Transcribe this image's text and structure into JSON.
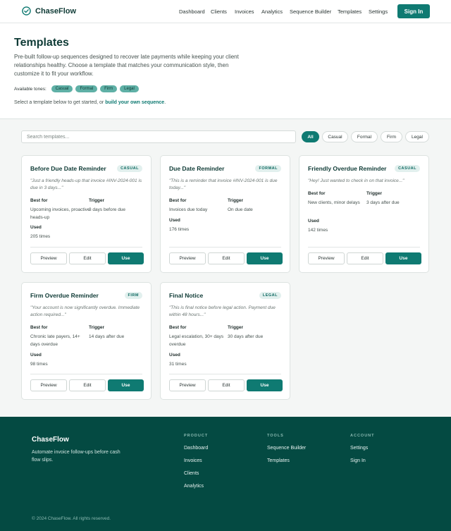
{
  "nav": {
    "brand": "ChaseFlow",
    "links": [
      "Dashboard",
      "Clients",
      "Invoices",
      "Analytics",
      "Sequence Builder",
      "Templates",
      "Settings"
    ],
    "signin": "Sign In"
  },
  "hero": {
    "title": "Templates",
    "description": "Pre-built follow-up sequences designed to recover late payments while keeping your client relationships healthy. Choose a template that matches your communication style, then customize it to fit your workflow.",
    "tones_label": "Available tones:",
    "tones": [
      "Casual",
      "Formal",
      "Firm",
      "Legal"
    ],
    "hint_prefix": "Select a template below to get started, or ",
    "hint_link": "build your own sequence",
    "hint_suffix": "."
  },
  "filters": {
    "search_placeholder": "Search templates...",
    "buttons": [
      "All",
      "Casual",
      "Formal",
      "Firm",
      "Legal"
    ],
    "active": "All"
  },
  "labels": {
    "best_for": "Best for",
    "trigger": "Trigger",
    "used": "Used",
    "preview": "Preview",
    "edit": "Edit",
    "use": "Use"
  },
  "templates": [
    {
      "title": "Before Due Date Reminder",
      "tone": "CASUAL",
      "quote": "\"Just a friendly heads-up that invoice #INV-2024-001 is due in 3 days...\"",
      "best_for": "Upcoming invoices, proactive heads-up",
      "trigger": "3 days before due",
      "used": "205 times"
    },
    {
      "title": "Due Date Reminder",
      "tone": "FORMAL",
      "quote": "\"This is a reminder that invoice #INV-2024-001 is due today...\"",
      "best_for": "Invoices due today",
      "trigger": "On due date",
      "used": "176 times"
    },
    {
      "title": "Friendly Overdue Reminder",
      "tone": "CASUAL",
      "quote": "\"Hey! Just wanted to check in on that invoice...\"",
      "best_for": "New clients, minor delays",
      "trigger": "3 days after due",
      "used": "142 times"
    },
    {
      "title": "Firm Overdue Reminder",
      "tone": "FIRM",
      "quote": "\"Your account is now significantly overdue. Immediate action required...\"",
      "best_for": "Chronic late payers, 14+ days overdue",
      "trigger": "14 days after due",
      "used": "98 times"
    },
    {
      "title": "Final Notice",
      "tone": "LEGAL",
      "quote": "\"This is final notice before legal action. Payment due within 48 hours...\"",
      "best_for": "Legal escalation, 30+ days overdue",
      "trigger": "30 days after due",
      "used": "31 times"
    }
  ],
  "footer": {
    "brand": "ChaseFlow",
    "tagline": "Automate invoice follow-ups before cash flow slips.",
    "columns": [
      {
        "heading": "PRODUCT",
        "links": [
          "Dashboard",
          "Invoices",
          "Clients",
          "Analytics"
        ]
      },
      {
        "heading": "TOOLS",
        "links": [
          "Sequence Builder",
          "Templates"
        ]
      },
      {
        "heading": "ACCOUNT",
        "links": [
          "Settings",
          "Sign In"
        ]
      }
    ],
    "copyright": "© 2024 ChaseFlow. All rights reserved."
  },
  "colors": {
    "accent": "#0f7a72",
    "footer_bg": "#044a42",
    "badge_bg": "#e2f0ee"
  }
}
